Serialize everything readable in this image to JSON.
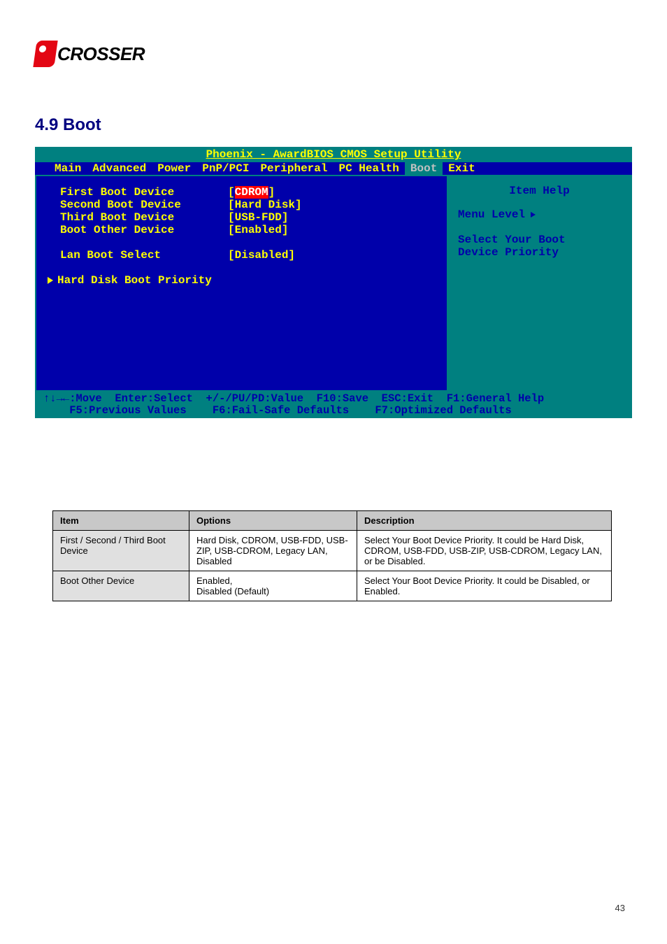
{
  "logo": {
    "text": "CROSSER"
  },
  "section_title": "4.9 Boot",
  "bios": {
    "title": "Phoenix - AwardBIOS CMOS Setup Utility",
    "menu": [
      "Main",
      "Advanced",
      "Power",
      "PnP/PCI",
      "Peripheral",
      "PC Health",
      "Boot",
      "Exit"
    ],
    "active_menu": "Boot",
    "rows": [
      {
        "label": "First Boot Device",
        "value": "CDROM",
        "highlight": true
      },
      {
        "label": "Second Boot Device",
        "value": "Hard Disk"
      },
      {
        "label": "Third Boot Device",
        "value": "USB-FDD"
      },
      {
        "label": "Boot Other Device",
        "value": "Enabled"
      }
    ],
    "lan_row": {
      "label": "Lan Boot Select",
      "value": "Disabled"
    },
    "submenu": "Hard Disk Boot Priority",
    "help": {
      "title": "Item Help",
      "menu_level": "Menu Level",
      "desc1": "Select Your Boot",
      "desc2": "Device Priority"
    },
    "footer": {
      "line1": "↑↓→←:Move  Enter:Select  +/-/PU/PD:Value  F10:Save  ESC:Exit  F1:General Help",
      "line2": "    F5:Previous Values    F6:Fail-Safe Defaults    F7:Optimized Defaults"
    }
  },
  "table": {
    "head": [
      "Item",
      "Options",
      "Description"
    ],
    "rows": [
      {
        "item": "First / Second / Third Boot Device",
        "options": "Hard Disk, CDROM, USB-FDD, USB-ZIP, USB-CDROM, Legacy LAN, Disabled",
        "desc": "Select Your Boot Device Priority. It could be Hard Disk, CDROM, USB-FDD, USB-ZIP, USB-CDROM, Legacy LAN, or be Disabled."
      },
      {
        "item": "Boot Other Device",
        "options_main": "Enabled,",
        "options_note": "Disabled (Default)",
        "desc": "Select Your Boot Device Priority. It could be Disabled, or Enabled."
      }
    ]
  },
  "page_number": "43"
}
